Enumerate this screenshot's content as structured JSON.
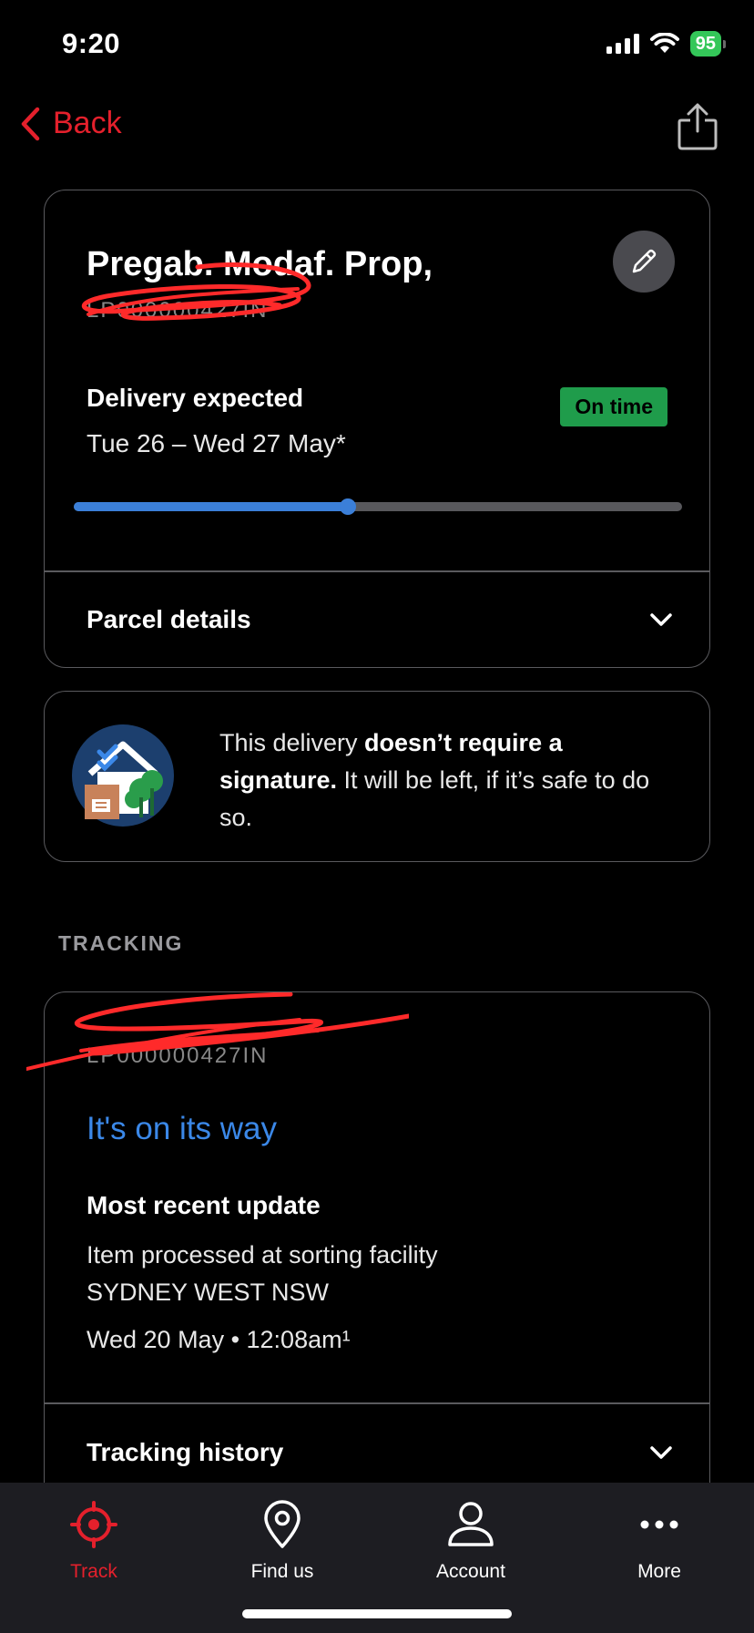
{
  "status_bar": {
    "time": "9:20",
    "battery": "95"
  },
  "nav": {
    "back_label": "Back"
  },
  "parcel": {
    "title": "Pregab. Modaf. Prop,",
    "tracking_id_redacted": "LP000000427IN",
    "delivery_label": "Delivery expected",
    "delivery_dates": "Tue 26 – Wed 27 May*",
    "status_badge": "On time",
    "progress_fraction": 0.45,
    "details_label": "Parcel details"
  },
  "signature_notice": {
    "text_before": "This delivery ",
    "text_bold": "doesn’t require a signature.",
    "text_after": " It will be left, if it’s safe to do so."
  },
  "tracking": {
    "section_heading": "TRACKING",
    "tracking_id_redacted": "LP000000427IN",
    "status": "It's on its way",
    "recent_update_label": "Most recent update",
    "update_line1": "Item processed at sorting facility",
    "update_line2": "SYDNEY WEST NSW",
    "update_time": "Wed 20 May • 12:08am¹",
    "history_label": "Tracking history"
  },
  "tabbar": {
    "tabs": [
      {
        "label": "Track",
        "icon": "crosshair-icon",
        "active": true
      },
      {
        "label": "Find us",
        "icon": "location-pin-icon",
        "active": false
      },
      {
        "label": "Account",
        "icon": "person-icon",
        "active": false
      },
      {
        "label": "More",
        "icon": "ellipsis-icon",
        "active": false
      }
    ]
  },
  "colors": {
    "accent_red": "#e4202c",
    "progress_blue": "#3b7fd8",
    "badge_green": "#1f9c4b",
    "link_blue": "#3b88e8"
  }
}
